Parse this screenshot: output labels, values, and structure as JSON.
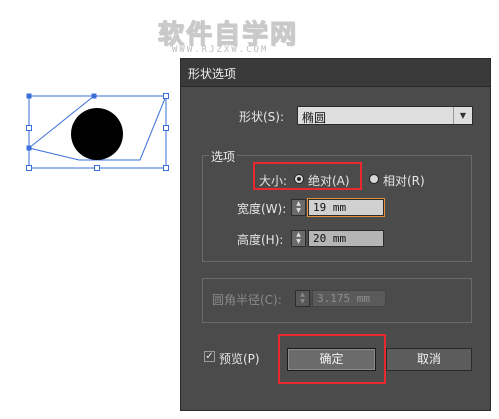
{
  "watermark": {
    "title": "软件自学网",
    "url": "WWW.RJZXW.COM"
  },
  "dialog": {
    "title": "形状选项",
    "shape": {
      "label": "形状(S):",
      "value": "椭圆"
    },
    "options_group": {
      "legend": "选项",
      "size_label": "大小:",
      "absolute_label": "绝对(A)",
      "relative_label": "相对(R)",
      "width_label": "宽度(W):",
      "width_value": "19 mm",
      "height_label": "高度(H):",
      "height_value": "20 mm"
    },
    "corner_radius": {
      "label": "圆角半径(C):",
      "value": "3.175 mm"
    },
    "preview": {
      "label": "预览(P)",
      "checked": true
    },
    "ok_label": "确定",
    "cancel_label": "取消"
  },
  "icons": {
    "dropdown": "triangle-down",
    "spinner": "up-down-arrows",
    "check": "checkmark"
  },
  "colors": {
    "highlight": "#e8282c",
    "focus_ring": "#e0903a"
  }
}
